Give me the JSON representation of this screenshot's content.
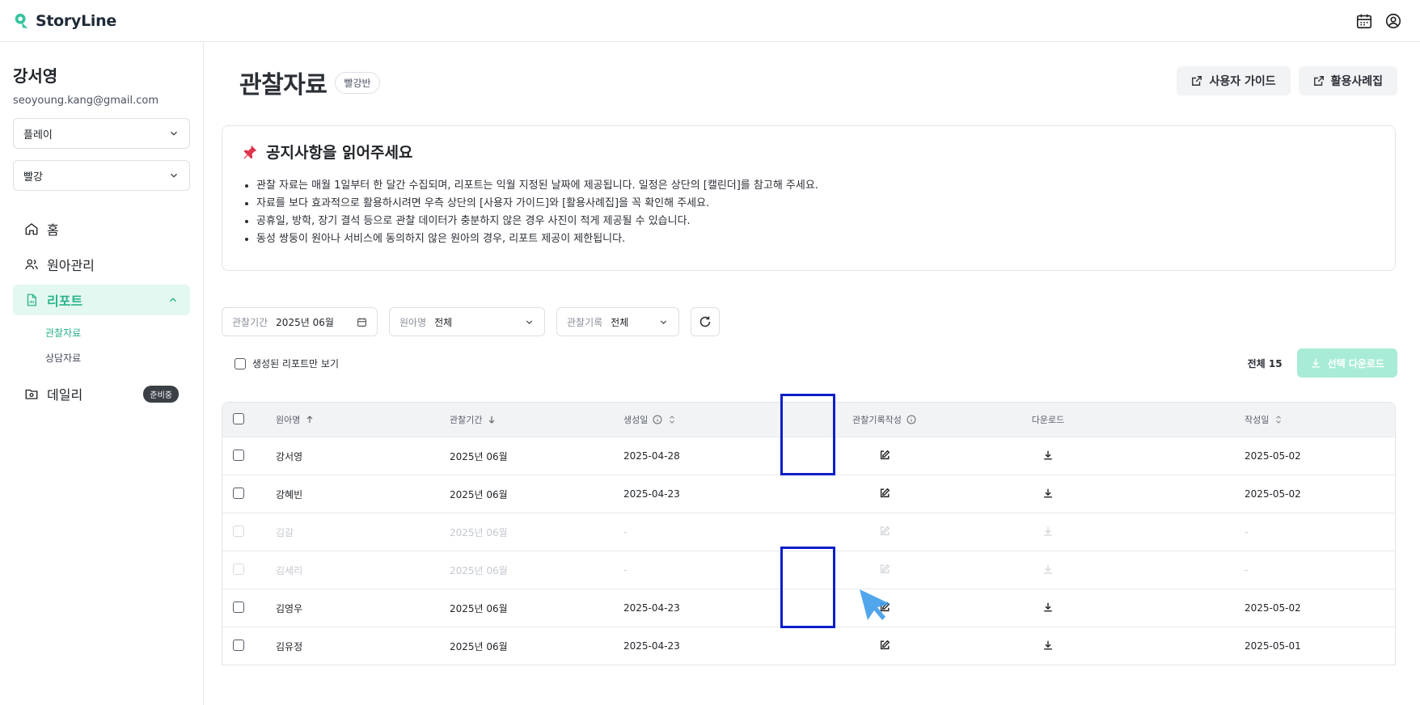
{
  "app": {
    "name": "StoryLine"
  },
  "user": {
    "name": "강서영",
    "email": "seoyoung.kang@gmail.com"
  },
  "sidebar": {
    "selects": [
      {
        "value": "플레이"
      },
      {
        "value": "빨강"
      }
    ],
    "nav": [
      {
        "label": "홈"
      },
      {
        "label": "원아관리"
      },
      {
        "label": "리포트"
      },
      {
        "label": "데일리",
        "badge": "준비중"
      }
    ],
    "sub_items": [
      {
        "label": "관찰자료"
      },
      {
        "label": "상담자료"
      }
    ]
  },
  "header": {
    "title": "관찰자료",
    "class_chip": "빨강반",
    "buttons": [
      {
        "label": "사용자 가이드"
      },
      {
        "label": "활용사례집"
      }
    ]
  },
  "notice": {
    "title": "공지사항을 읽어주세요",
    "items": [
      "관찰 자료는 매월 1일부터 한 달간 수집되며, 리포트는 익월 지정된 날짜에 제공됩니다. 일정은 상단의 [캘린더]를 참고해 주세요.",
      "자료를 보다 효과적으로 활용하시려면 우측 상단의 [사용자 가이드]와 [활용사례집]을 꼭 확인해 주세요.",
      "공휴일, 방학, 장기 결석 등으로 관찰 데이터가 충분하지 않은 경우 사진이 적게 제공될 수 있습니다.",
      "동성 쌍둥이 원아나 서비스에 동의하지 않은 원아의 경우, 리포트 제공이 제한됩니다."
    ]
  },
  "filters": {
    "period": {
      "label": "관찰기간",
      "value": "2025년 06월"
    },
    "child": {
      "label": "원아명",
      "value": "전체"
    },
    "record": {
      "label": "관찰기록",
      "value": "전체"
    }
  },
  "only_generated_label": "생성된 리포트만 보기",
  "total_label": "전체 15",
  "download_selected_label": "선택 다운로드",
  "table": {
    "headers": [
      "원아명",
      "관찰기간",
      "생성일",
      "관찰기록작성",
      "다운로드",
      "작성일"
    ],
    "rows": [
      {
        "name": "강서영",
        "period": "2025년 06월",
        "created": "2025-04-28",
        "written": "2025-05-02",
        "disabled": false
      },
      {
        "name": "강혜빈",
        "period": "2025년 06월",
        "created": "2025-04-23",
        "written": "2025-05-02",
        "disabled": false
      },
      {
        "name": "김갈",
        "period": "2025년 06월",
        "created": "-",
        "written": "-",
        "disabled": true
      },
      {
        "name": "김세리",
        "period": "2025년 06월",
        "created": "-",
        "written": "-",
        "disabled": true
      },
      {
        "name": "김영우",
        "period": "2025년 06월",
        "created": "2025-04-23",
        "written": "2025-05-02",
        "disabled": false
      },
      {
        "name": "김유정",
        "period": "2025년 06월",
        "created": "2025-04-23",
        "written": "2025-05-01",
        "disabled": false
      }
    ]
  },
  "colors": {
    "accent": "#2bb38b",
    "accent_light": "#e3f8f1",
    "highlight": "#0a1ec8",
    "cursor": "#3d9be9"
  }
}
